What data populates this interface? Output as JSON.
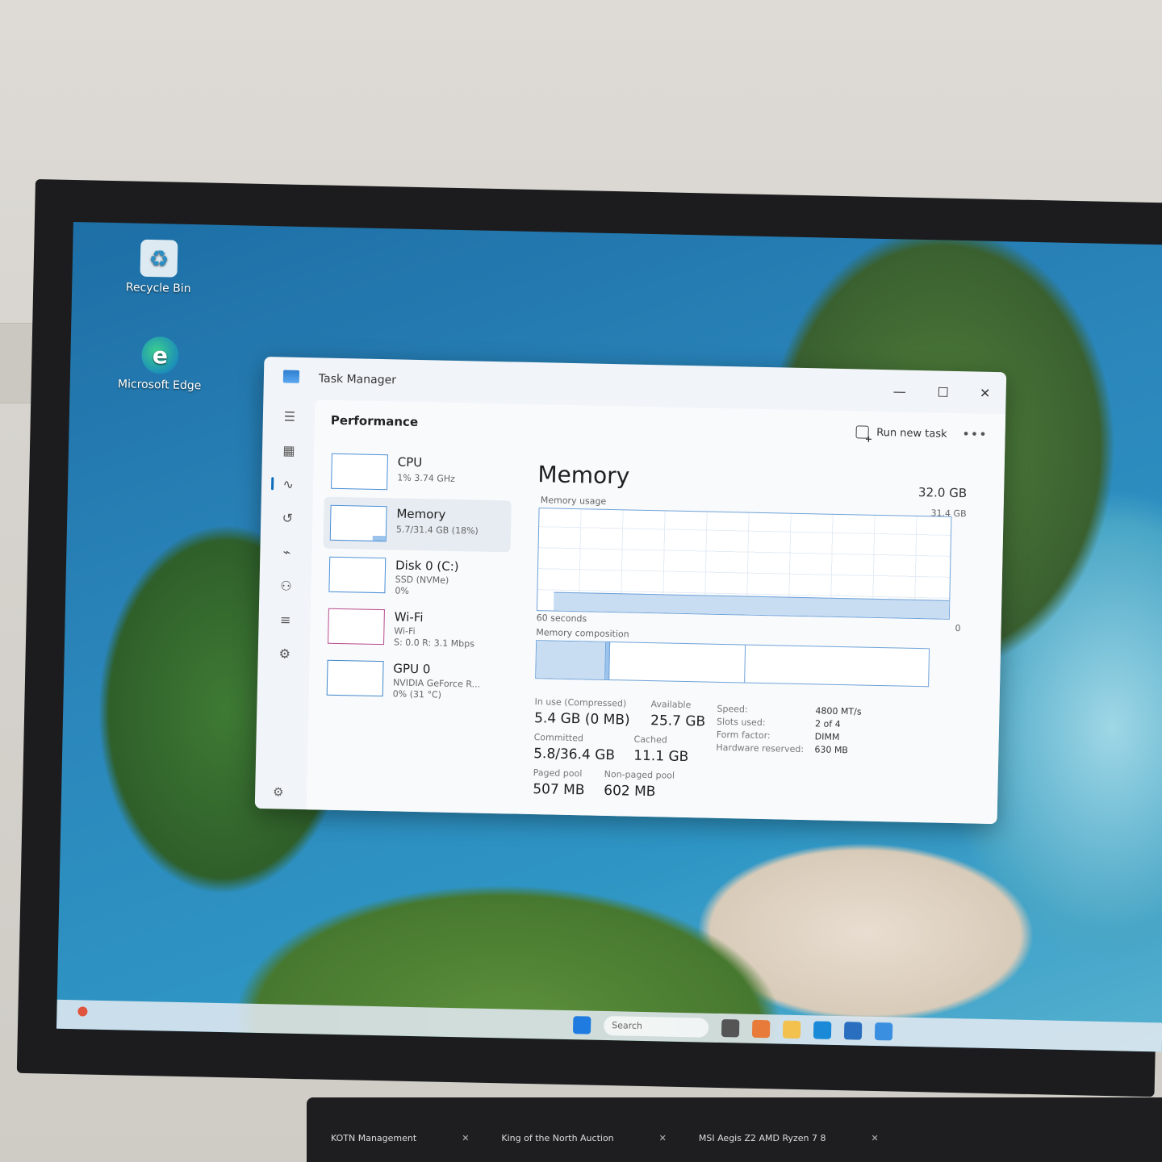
{
  "desktop": {
    "icons": [
      {
        "label": "Recycle Bin",
        "icon": "recycle-bin-icon"
      },
      {
        "label": "Microsoft Edge",
        "icon": "edge-icon"
      }
    ]
  },
  "window": {
    "title": "Task Manager",
    "controls": {
      "minimize": "—",
      "maximize": "☐",
      "close": "✕"
    }
  },
  "toolbar": {
    "page_title": "Performance",
    "run_new_task": "Run new task",
    "more": "•••"
  },
  "rail_icons": [
    "menu-icon",
    "processes-icon",
    "performance-icon",
    "app-history-icon",
    "startup-icon",
    "users-icon",
    "details-icon",
    "services-icon"
  ],
  "perf_list": [
    {
      "name": "CPU",
      "line1": "1% 3.74 GHz",
      "line2": ""
    },
    {
      "name": "Memory",
      "line1": "5.7/31.4 GB (18%)",
      "line2": ""
    },
    {
      "name": "Disk 0 (C:)",
      "line1": "SSD (NVMe)",
      "line2": "0%"
    },
    {
      "name": "Wi-Fi",
      "line1": "Wi-Fi",
      "line2": "S: 0.0 R: 3.1 Mbps"
    },
    {
      "name": "GPU 0",
      "line1": "NVIDIA GeForce R...",
      "line2": "0% (31 °C)"
    }
  ],
  "memory": {
    "title": "Memory",
    "total": "32.0 GB",
    "usage_label": "Memory usage",
    "usage_max": "31.4 GB",
    "usage_fraction": 0.18,
    "graph_time": "60 seconds",
    "graph_min": "0",
    "composition_label": "Memory composition",
    "stats": {
      "in_use": {
        "label": "In use (Compressed)",
        "value": "5.4 GB (0 MB)"
      },
      "available": {
        "label": "Available",
        "value": "25.7 GB"
      },
      "committed": {
        "label": "Committed",
        "value": "5.8/36.4 GB"
      },
      "cached": {
        "label": "Cached",
        "value": "11.1 GB"
      },
      "paged_pool": {
        "label": "Paged pool",
        "value": "507 MB"
      },
      "non_paged_pool": {
        "label": "Non-paged pool",
        "value": "602 MB"
      }
    },
    "specs": [
      {
        "key": "Speed:",
        "value": "4800 MT/s"
      },
      {
        "key": "Slots used:",
        "value": "2 of 4"
      },
      {
        "key": "Form factor:",
        "value": "DIMM"
      },
      {
        "key": "Hardware reserved:",
        "value": "630 MB"
      }
    ]
  },
  "taskbar": {
    "search_placeholder": "Search"
  },
  "browser_tabs": [
    {
      "label": "KOTN Management"
    },
    {
      "label": "King of the North Auction"
    },
    {
      "label": "MSI Aegis Z2 AMD Ryzen 7 8"
    }
  ],
  "colors": {
    "accent": "#0f6cbd",
    "memory_graph": "#6ea2d8",
    "wifi_graph": "#b84a8e"
  }
}
